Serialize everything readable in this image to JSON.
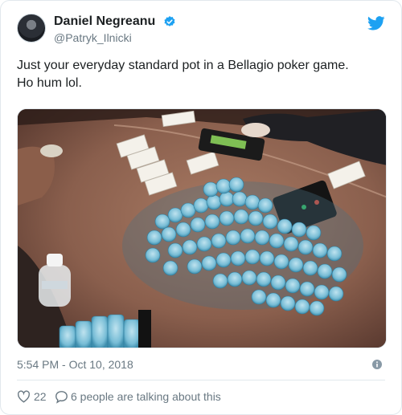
{
  "user": {
    "name": "Daniel Negreanu",
    "handle": "@Patryk_Ilnicki"
  },
  "tweet": {
    "line1": "Just your everyday standard pot in a Bellagio poker game.",
    "line2": "Ho hum lol."
  },
  "meta": {
    "timestamp": "5:54 PM - Oct 10, 2018"
  },
  "actions": {
    "like_count": "22",
    "reply_text": "6 people are talking about this"
  },
  "icons": {
    "verified": "verified-badge-icon",
    "bird": "twitter-bird-icon",
    "info": "info-icon",
    "like": "heart-icon",
    "reply": "speech-bubble-icon"
  },
  "colors": {
    "brand": "#1da1f2",
    "text": "#1c2022",
    "muted": "#697882",
    "border": "#e1e8ed"
  }
}
